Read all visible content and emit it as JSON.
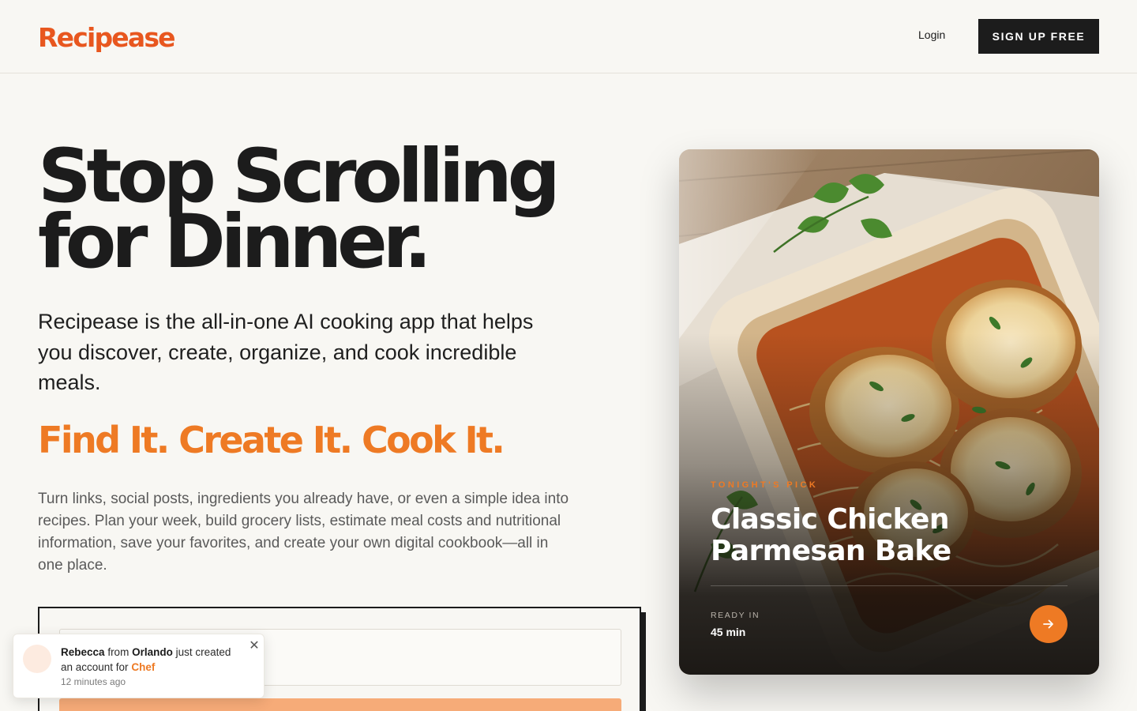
{
  "header": {
    "logo": "Recipease",
    "login_label": "Login",
    "signup_label": "SIGN UP FREE"
  },
  "hero": {
    "title": "Stop Scrolling for Dinner.",
    "subtitle": "Recipease is the all-in-one AI cooking app that helps you discover, create, organize, and cook incredible meals.",
    "tagline": "Find It. Create It. Cook It.",
    "description": "Turn links, social posts, ingredients you already have, or even a simple idea into recipes. Plan your week, build grocery lists, estimate meal costs and nutritional information, save your favorites, and create your own digital cookbook—all in one place."
  },
  "form": {
    "input_value": "",
    "input_placeholder": "",
    "cta_label": ""
  },
  "toast": {
    "name": "Rebecca",
    "from_word": "from",
    "city": "Orlando",
    "action": "just created an account for",
    "plan": "Chef",
    "time": "12 minutes ago",
    "close_icon": "close-icon"
  },
  "card": {
    "label": "TONIGHT'S PICK",
    "title": "Classic Chicken Parmesan Bake",
    "ready_label": "READY IN",
    "ready_value": "45 min",
    "arrow_icon": "arrow-right-icon"
  },
  "colors": {
    "accent": "#ee7a24",
    "logo": "#e8571f",
    "background": "#f8f7f3",
    "dark": "#1c1c1c"
  }
}
